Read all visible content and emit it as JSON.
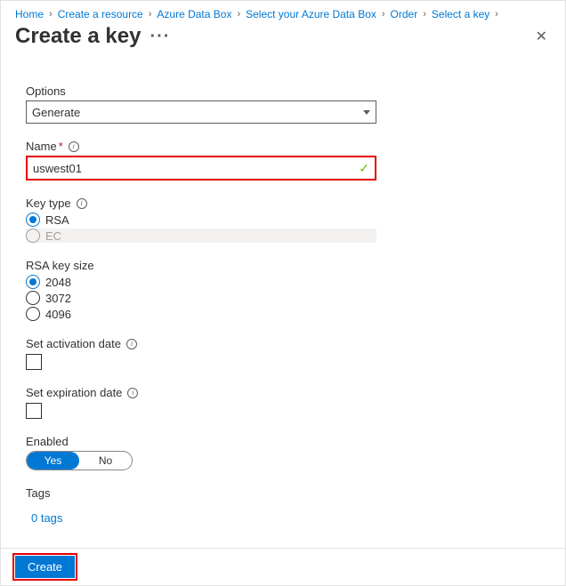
{
  "breadcrumb": {
    "items": [
      {
        "label": "Home"
      },
      {
        "label": "Create a resource"
      },
      {
        "label": "Azure Data Box"
      },
      {
        "label": "Select your Azure Data Box"
      },
      {
        "label": "Order"
      },
      {
        "label": "Select a key"
      }
    ]
  },
  "header": {
    "title": "Create a key"
  },
  "form": {
    "options": {
      "label": "Options",
      "value": "Generate"
    },
    "name": {
      "label": "Name",
      "value": "uswest01"
    },
    "keytype": {
      "label": "Key type",
      "rsa": "RSA",
      "ec": "EC"
    },
    "keysize": {
      "label": "RSA key size",
      "o1": "2048",
      "o2": "3072",
      "o3": "4096"
    },
    "activation": {
      "label": "Set activation date"
    },
    "expiration": {
      "label": "Set expiration date"
    },
    "enabled": {
      "label": "Enabled",
      "yes": "Yes",
      "no": "No"
    },
    "tags": {
      "label": "Tags",
      "link": "0 tags"
    }
  },
  "footer": {
    "create": "Create"
  }
}
